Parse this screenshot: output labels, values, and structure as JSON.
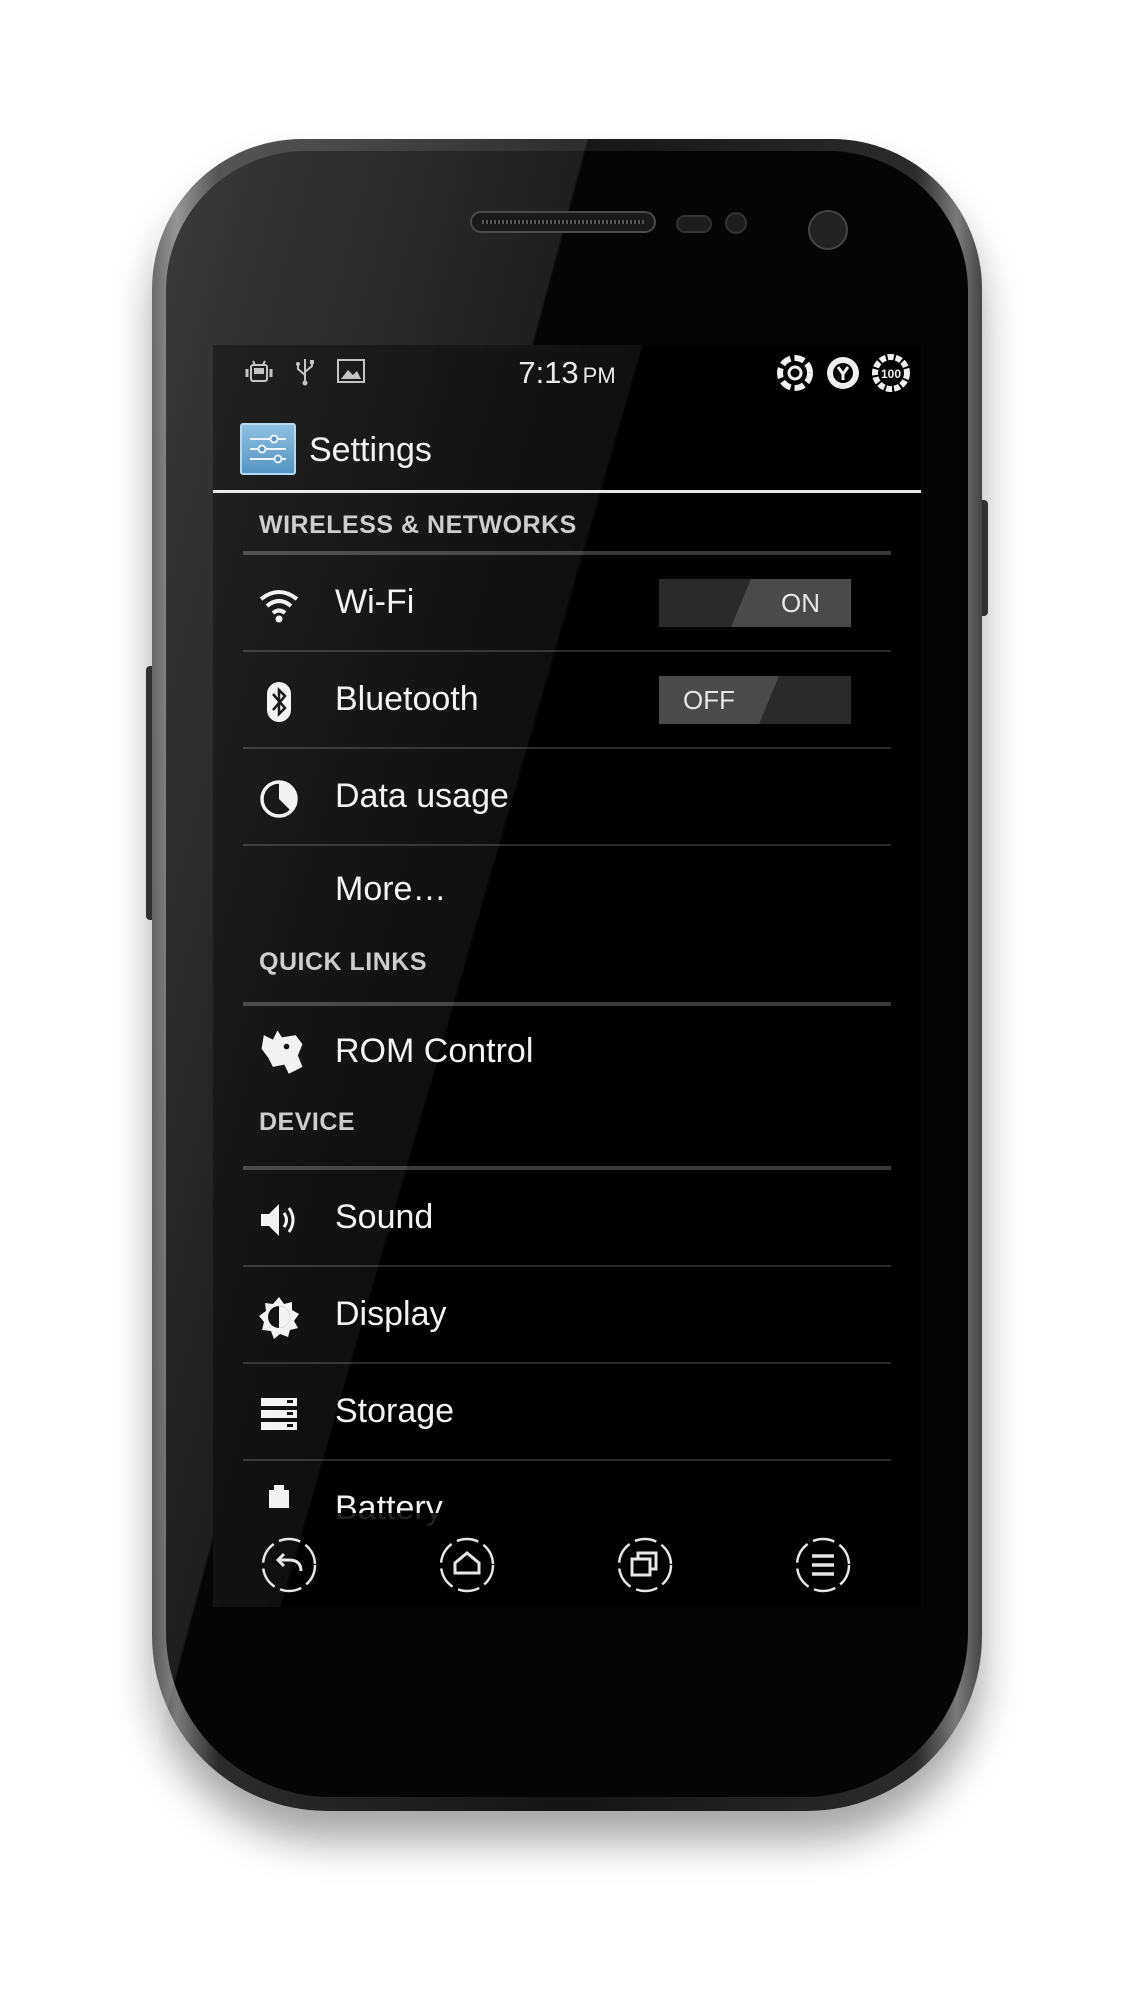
{
  "statusbar": {
    "time": "7:13",
    "ampm": "PM",
    "left_icons": [
      "android-debug-icon",
      "usb-icon",
      "image-icon"
    ],
    "right_icons": [
      "sync-ring-icon",
      "alarm-ring-icon",
      "battery-ring-icon"
    ],
    "battery_text": "100"
  },
  "actionbar": {
    "title": "Settings",
    "icon": "settings-sliders-icon"
  },
  "sections": {
    "wireless": "WIRELESS & NETWORKS",
    "quick_links": "QUICK LINKS",
    "device": "DEVICE"
  },
  "items": {
    "wifi": {
      "label": "Wi-Fi",
      "toggle": "ON"
    },
    "bluetooth": {
      "label": "Bluetooth",
      "toggle": "OFF"
    },
    "data_usage": {
      "label": "Data usage"
    },
    "more": {
      "label": "More…"
    },
    "rom_control": {
      "label": "ROM Control"
    },
    "sound": {
      "label": "Sound"
    },
    "display": {
      "label": "Display"
    },
    "storage": {
      "label": "Storage"
    },
    "battery": {
      "label": "Battery"
    }
  },
  "navbar": [
    "back-icon",
    "home-icon",
    "recents-icon",
    "menu-icon"
  ],
  "colors": {
    "screen_bg": "#000000",
    "text": "#f2f2f2",
    "section_text": "#c9c9c9",
    "divider": "#3a3a3a",
    "accent": "#4f93c6"
  }
}
